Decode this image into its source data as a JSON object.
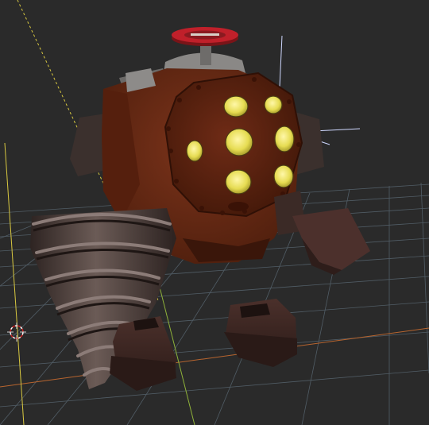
{
  "viewport": {
    "background_color": "#2a2a2a",
    "grid_line_color": "#5e6e7a",
    "x_axis_color": "#b8652f",
    "y_axis_color": "#8fb23a",
    "z_axis_color": "#d8c840"
  },
  "model": {
    "body_color": "#6b2a14",
    "body_shadow_color": "#3f1a0d",
    "helmet_color": "#5a2311",
    "porthole_color": "#e8df5c",
    "drill_color": "#4a3a36",
    "drill_highlight_color": "#8c7c78",
    "valve_color": "#c0202a",
    "boot_color": "#3a2420",
    "hand_color": "#4c302c"
  },
  "icons": {
    "cursor": "3d-cursor-icon"
  }
}
